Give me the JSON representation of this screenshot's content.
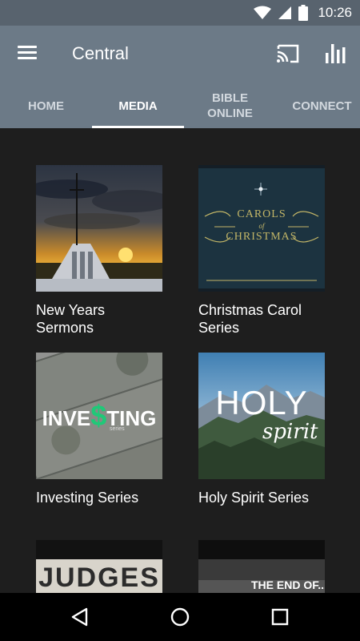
{
  "status_bar": {
    "time": "10:26",
    "icons": [
      "wifi-icon",
      "cell-signal-icon",
      "battery-icon"
    ]
  },
  "app_bar": {
    "title": "Central",
    "icons": [
      "menu-icon",
      "cast-icon",
      "bar-chart-icon"
    ]
  },
  "tabs": [
    {
      "label": "HOME",
      "active": false
    },
    {
      "label": "MEDIA",
      "active": true
    },
    {
      "label": "BIBLE\nONLINE",
      "active": false
    },
    {
      "label": "CONNECT",
      "active": false
    }
  ],
  "media_items": [
    {
      "title": "New Years Sermons"
    },
    {
      "title": "Christmas Carol Series",
      "art_text": [
        "CAROLS",
        "of",
        "CHRISTMAS"
      ]
    },
    {
      "title": "Investing Series",
      "art_text": [
        "INVE",
        "$",
        "TING",
        "series"
      ]
    },
    {
      "title": "Holy Spirit Series",
      "art_text": [
        "HOLY",
        "spirit"
      ]
    },
    {
      "title": "",
      "art_text": [
        "JUDGES"
      ]
    },
    {
      "title": "",
      "art_text": [
        "THE END OF..."
      ]
    }
  ],
  "nav_bar": {
    "icons": [
      "back-icon",
      "home-icon",
      "recents-icon"
    ]
  },
  "colors": {
    "status_bar": "#58636e",
    "app_bar": "#6c7a87",
    "background": "#1e1e1e",
    "nav_bar": "#000000",
    "investing_accent": "#1fc978"
  }
}
